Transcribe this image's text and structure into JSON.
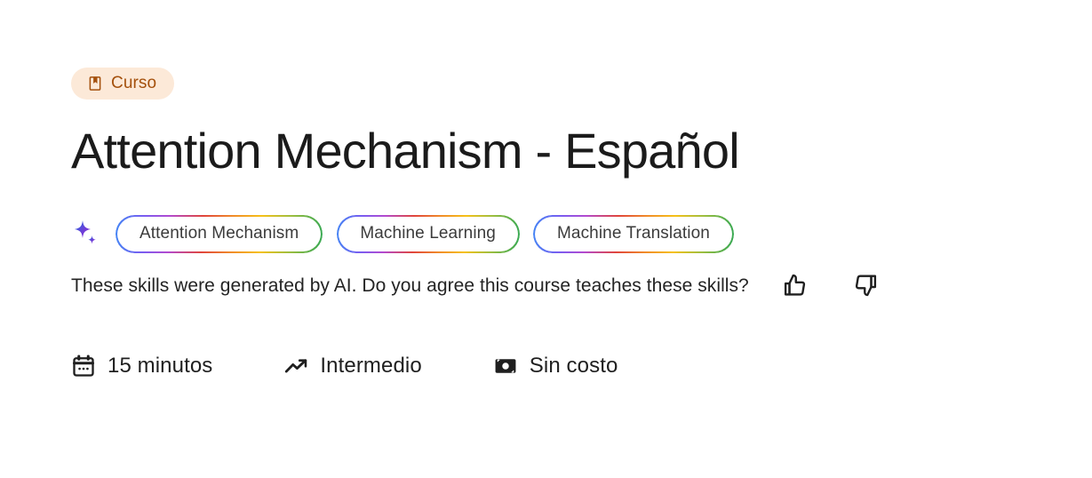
{
  "badge": {
    "label": "Curso",
    "icon": "book-bookmark-icon",
    "bg_color": "#FCE9D8",
    "text_color": "#A4500C"
  },
  "title": "Attention Mechanism - Español",
  "skills": {
    "sparkle_icon": "ai-sparkle-icon",
    "chips": [
      {
        "label": "Attention Mechanism"
      },
      {
        "label": "Machine Learning"
      },
      {
        "label": "Machine Translation"
      }
    ],
    "gradient_colors": [
      "#4285F4",
      "#7B5CF0",
      "#B24AD0",
      "#E0453C",
      "#F08A2A",
      "#F6C118",
      "#9FBE3F",
      "#34A853"
    ]
  },
  "disclaimer": {
    "text": "These skills were generated by AI. Do you agree this course teaches these skills?",
    "thumb_up_icon": "thumb-up-icon",
    "thumb_down_icon": "thumb-down-icon"
  },
  "meta": [
    {
      "icon": "calendar-icon",
      "label": "15 minutos"
    },
    {
      "icon": "trending-up-icon",
      "label": "Intermedio"
    },
    {
      "icon": "money-icon",
      "label": "Sin costo"
    }
  ]
}
